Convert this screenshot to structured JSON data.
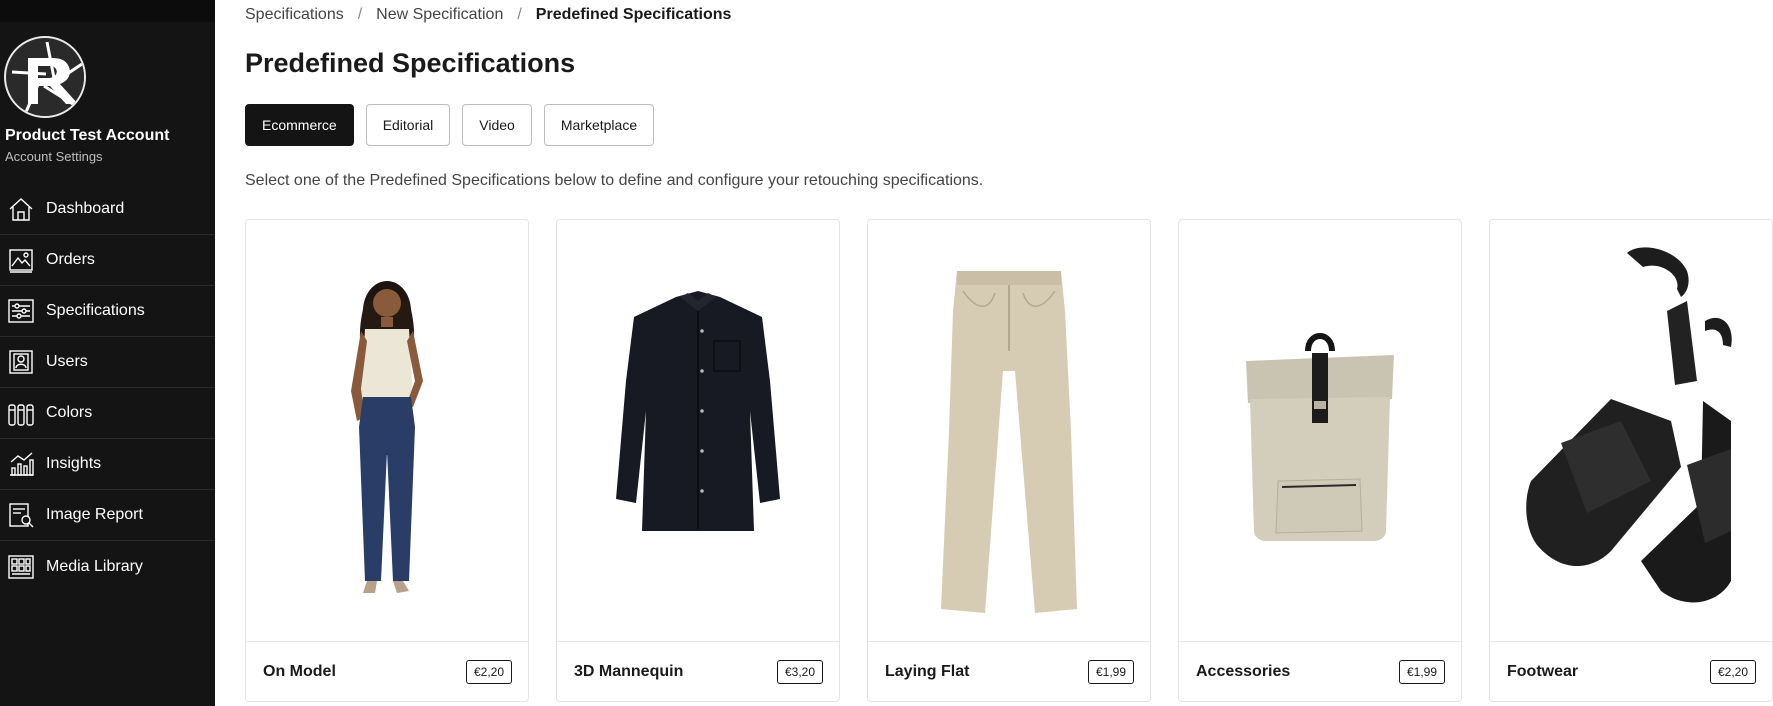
{
  "sidebar": {
    "account_name": "Product Test Account",
    "account_settings": "Account Settings",
    "items": [
      {
        "label": "Dashboard",
        "icon": "home-icon"
      },
      {
        "label": "Orders",
        "icon": "image-icon"
      },
      {
        "label": "Specifications",
        "icon": "sliders-icon"
      },
      {
        "label": "Users",
        "icon": "user-card-icon"
      },
      {
        "label": "Colors",
        "icon": "swatches-icon"
      },
      {
        "label": "Insights",
        "icon": "chart-icon"
      },
      {
        "label": "Image Report",
        "icon": "report-search-icon"
      },
      {
        "label": "Media Library",
        "icon": "grid-icon"
      }
    ]
  },
  "breadcrumb": [
    "Specifications",
    "New Specification",
    "Predefined Specifications"
  ],
  "page_title": "Predefined Specifications",
  "tabs": [
    {
      "label": "Ecommerce",
      "active": true
    },
    {
      "label": "Editorial",
      "active": false
    },
    {
      "label": "Video",
      "active": false
    },
    {
      "label": "Marketplace",
      "active": false
    }
  ],
  "intro": "Select one of the Predefined Specifications below to define and configure your retouching specifications.",
  "cards": [
    {
      "title": "On Model",
      "price": "€2,20",
      "image": "on-model-photo"
    },
    {
      "title": "3D Mannequin",
      "price": "€3,20",
      "image": "shirt-photo"
    },
    {
      "title": "Laying Flat",
      "price": "€1,99",
      "image": "jeans-photo"
    },
    {
      "title": "Accessories",
      "price": "€1,99",
      "image": "backpack-photo"
    },
    {
      "title": "Footwear",
      "price": "€2,20",
      "image": "sandals-photo"
    }
  ],
  "colors": {
    "sidebar_bg": "#141414",
    "active_tab_bg": "#141414",
    "text": "#1a1a1a"
  }
}
